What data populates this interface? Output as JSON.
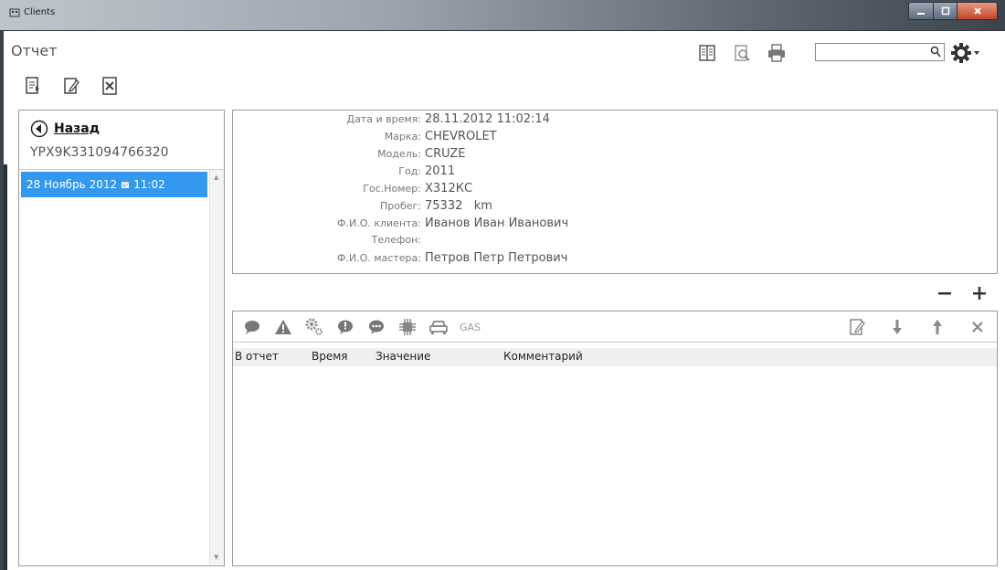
{
  "window": {
    "title": "Clients"
  },
  "page": {
    "title": "Отчет"
  },
  "search": {
    "value": "",
    "placeholder": ""
  },
  "left_panel": {
    "back_label": "Назад",
    "vin": "YPX9K331094766320",
    "items": [
      {
        "date": "28 Ноябрь 2012",
        "time": "11:02"
      }
    ]
  },
  "info": {
    "rows": [
      {
        "label": "Дата и время:",
        "value": "28.11.2012 11:02:14"
      },
      {
        "label": "Марка:",
        "value": "CHEVROLET"
      },
      {
        "label": "Модель:",
        "value": "CRUZE"
      },
      {
        "label": "Год:",
        "value": "2011"
      },
      {
        "label": "Гос.Номер:",
        "value": "Х312КС"
      },
      {
        "label": "Пробег:",
        "value": "75332   km"
      },
      {
        "label": "Ф.И.О. клиента:",
        "value": "Иванов Иван Иванович"
      },
      {
        "label": "Телефон:",
        "value": ""
      },
      {
        "label": "Ф.И.О. мастера:",
        "value": "Петров Петр Петрович"
      }
    ]
  },
  "events": {
    "gas_label": "GAS",
    "columns": [
      "В отчет",
      "Время",
      "Значение",
      "Комментарий"
    ]
  },
  "colors": {
    "selection": "#3399ee",
    "titlebar": "#5f6872"
  }
}
